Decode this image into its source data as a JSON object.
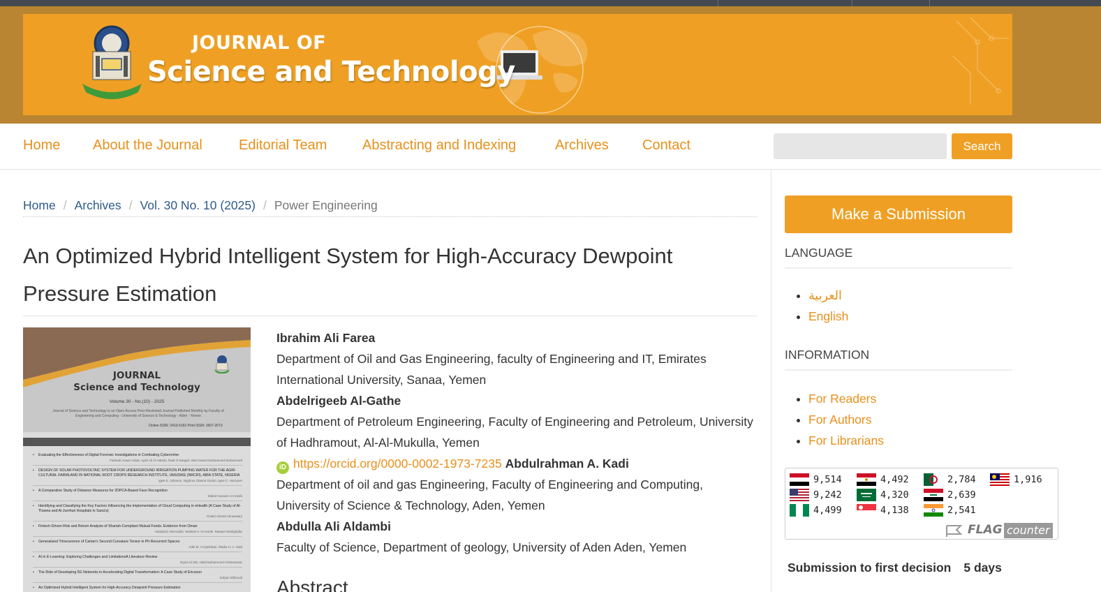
{
  "header": {
    "journal_of": "JOURNAL OF",
    "journal_name": "Science and Technology"
  },
  "nav": {
    "items": [
      "Home",
      "About the Journal",
      "Editorial Team",
      "Abstracting and Indexing",
      "Archives",
      "Contact"
    ],
    "search_label": "Search",
    "search_value": ""
  },
  "breadcrumb": {
    "items": [
      "Home",
      "Archives",
      "Vol. 30 No. 10 (2025)"
    ],
    "current": "Power Engineering"
  },
  "article": {
    "title": "An Optimized Hybrid Intelligent System for High-Accuracy Dewpoint Pressure Estimation",
    "authors": [
      {
        "name": "Ibrahim Ali Farea",
        "affiliation": "Department of Oil and Gas Engineering, faculty of Engineering and IT, Emirates International University, Sanaa, Yemen"
      },
      {
        "name": "Abdelrigeeb Al-Gathe",
        "affiliation": "Department of Petroleum Engineering, Faculty of Engineering and Petroleum, University of Hadhramout, Al-Al-Mukulla, Yemen",
        "orcid": "https://orcid.org/0000-0002-1973-7235"
      },
      {
        "name": "Abdulrahman A. Kadi",
        "affiliation": "Department of oil and gas Engineering, Faculty of Engineering and Computing, University of Science & Technology, Aden, Yemen"
      },
      {
        "name": "Abdulla Ali Aldambi",
        "affiliation": "Faculty of Science, Department of geology, University of Aden Aden, Yemen"
      }
    ],
    "abstract_heading": "Abstract"
  },
  "cover": {
    "line1": "JOURNAL",
    "line2": "Science and Technology",
    "volume": "Volume 30 - No.(10) - 2025",
    "desc": "Journal of Science and Technology is an Open Access Peer-Reviewed Journal Published Monthly by Faculty of Engineering and Computing - University of Science & Technology - Aden - Yemen",
    "issn": "Online ISSN: 2410-5163     Print ISSN: 1607-2073",
    "toc": [
      {
        "title": "Evaluating the Effectiveness of Digital Forensic Investigations in Combating Cybercrime",
        "authors": "Fatimah Anwar Asbar, Ayah Ali Al-Habshi, Raal Al-Saqqaf, Wed Saeed Mohammed Mohammed"
      },
      {
        "title": "DESIGN OF SOLAR PHOTOVOLTAIC SYSTEM FOR UNDERGROUND IRRIGATION PUMPING WATER FOR THE AGRI-CULTURAL FARMLAND IN NATIONAL ROOT CROPS RESEARCH INSTITUTE, UMUDIKE (NRCRI), ABIA STATE, NIGERIA",
        "authors": "Igwe E. Johnson, Nyghrus Olanna Onoko, Igwe C. Harrysun"
      },
      {
        "title": "A Comparative Study of Distance Measures for 2DPCA-Based Face Recognition",
        "authors": "Waled Hussein Al-Arashi"
      },
      {
        "title": "Identifying and Classifying the Key Factors Influencing the Implementation of Cloud Computing in eHealth (A Case Study of Al-Thawra and Al-Jumhuri Hospitals in Sana'a)",
        "authors": "Khalid Ahmed Almeswary"
      },
      {
        "title": "Fintech-Driven Risk and Return Analysis of Shariah-Compliant Mutual Funds: Evidence from Oman",
        "authors": "Abdulaziz Alismailah, Waleed H. Al-Arashi, Rawad Abdulghafar"
      },
      {
        "title": "Generalized Trinecurence of Cartan's Second Curvature Tensor in Ph-Recurrent Spaces",
        "authors": "Adel M. Al-Qashbari, Wadia H. A. Haid"
      },
      {
        "title": "AI in E-Learning: Exploring Challenges and LimitationsA Literature Review",
        "authors": "Ryad Ali Obi, Nabil Mohammed Al-Munassar"
      },
      {
        "title": "The Role of Developing 5G Networks in Accelerating Digital Transformation: A Case Study of Ericsson",
        "authors": "Sufyan Elkhoudi"
      },
      {
        "title": "An Optimized Hybrid Intelligent System for High-Accuracy Dewpoint Pressure Estimation",
        "authors": ""
      }
    ]
  },
  "sidebar": {
    "submit_label": "Make a Submission",
    "language_heading": "LANGUAGE",
    "languages": [
      "العربية",
      "English"
    ],
    "information_heading": "INFORMATION",
    "information_links": [
      "For Readers",
      "For Authors",
      "For Librarians"
    ],
    "flag_counter": {
      "entries": [
        {
          "flag": "yemen-flag",
          "count": "9,514"
        },
        {
          "flag": "usa-flag",
          "count": "9,242"
        },
        {
          "flag": "nigeria-flag",
          "count": "4,499"
        },
        {
          "flag": "egypt-flag",
          "count": "4,492"
        },
        {
          "flag": "saudi-flag",
          "count": "4,320"
        },
        {
          "flag": "singapore-flag",
          "count": "4,138"
        },
        {
          "flag": "algeria-flag",
          "count": "2,784"
        },
        {
          "flag": "iraq-flag",
          "count": "2,639"
        },
        {
          "flag": "india-flag",
          "count": "2,541"
        },
        {
          "flag": "malaysia-flag",
          "count": "1,916"
        }
      ],
      "logo_flag": "FLAG",
      "logo_counter": "counter"
    },
    "decision_label": "Submission to first decision",
    "decision_value": "5 days"
  },
  "colors": {
    "accent": "#efa024",
    "link_orange": "#e8901a",
    "header_band": "#b98532",
    "breadcrumb_link": "#2d5a8a",
    "orcid_green": "#a6ce39"
  }
}
